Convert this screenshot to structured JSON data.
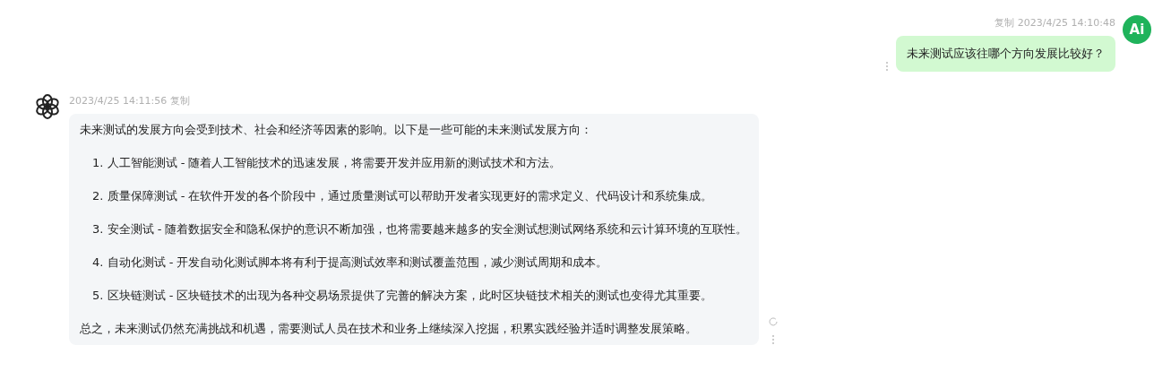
{
  "messages": [
    {
      "kind": "user",
      "copy_label": "复制",
      "time": "2023/4/25 14:10:48",
      "avatar_text": "Ai",
      "text": "未来测试应该往哪个方向发展比较好？"
    },
    {
      "kind": "assistant",
      "copy_label": "复制",
      "time": "2023/4/25 14:11:56",
      "intro": "未来测试的发展方向会受到技术、社会和经济等因素的影响。以下是一些可能的未来测试发展方向：",
      "items": [
        "1. 人工智能测试 - 随着人工智能技术的迅速发展，将需要开发并应用新的测试技术和方法。",
        "2. 质量保障测试 - 在软件开发的各个阶段中，通过质量测试可以帮助开发者实现更好的需求定义、代码设计和系统集成。",
        "3. 安全测试 - 随着数据安全和隐私保护的意识不断加强，也将需要越来越多的安全测试想测试网络系统和云计算环境的互联性。",
        "4. 自动化测试 - 开发自动化测试脚本将有利于提高测试效率和测试覆盖范围，减少测试周期和成本。",
        "5. 区块链测试 - 区块链技术的出现为各种交易场景提供了完善的解决方案，此时区块链技术相关的测试也变得尤其重要。"
      ],
      "conclusion": "总之，未来测试仍然充满挑战和机遇，需要测试人员在技术和业务上继续深入挖掘，积累实践经验并适时调整发展策略。"
    }
  ]
}
